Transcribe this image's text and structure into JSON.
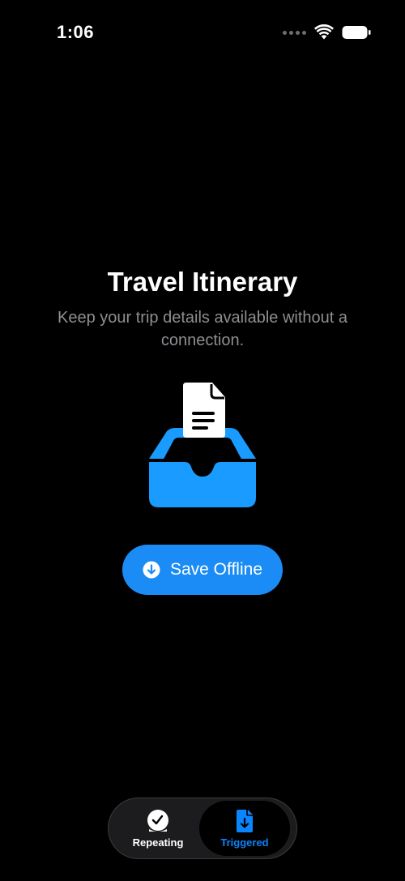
{
  "status_bar": {
    "time": "1:06",
    "signal_icon": "signal-dots-icon",
    "wifi_icon": "wifi-icon",
    "battery_icon": "battery-icon"
  },
  "main": {
    "title": "Travel Itinerary",
    "subtitle": "Keep your trip details available without a connection.",
    "illustration_icon": "document-in-tray-icon",
    "save_button": {
      "label": "Save Offline",
      "icon": "arrow-down-circle-icon"
    }
  },
  "tab_bar": {
    "tabs": [
      {
        "label": "Repeating",
        "icon": "clock-icon",
        "selected": false
      },
      {
        "label": "Triggered",
        "icon": "document-download-icon",
        "selected": true
      }
    ]
  },
  "colors": {
    "background": "#000000",
    "accent": "#0a84ff",
    "button": "#1b8cf5",
    "subtitle_gray": "#8e8e93",
    "tab_bar_background": "#1c1c1e"
  }
}
